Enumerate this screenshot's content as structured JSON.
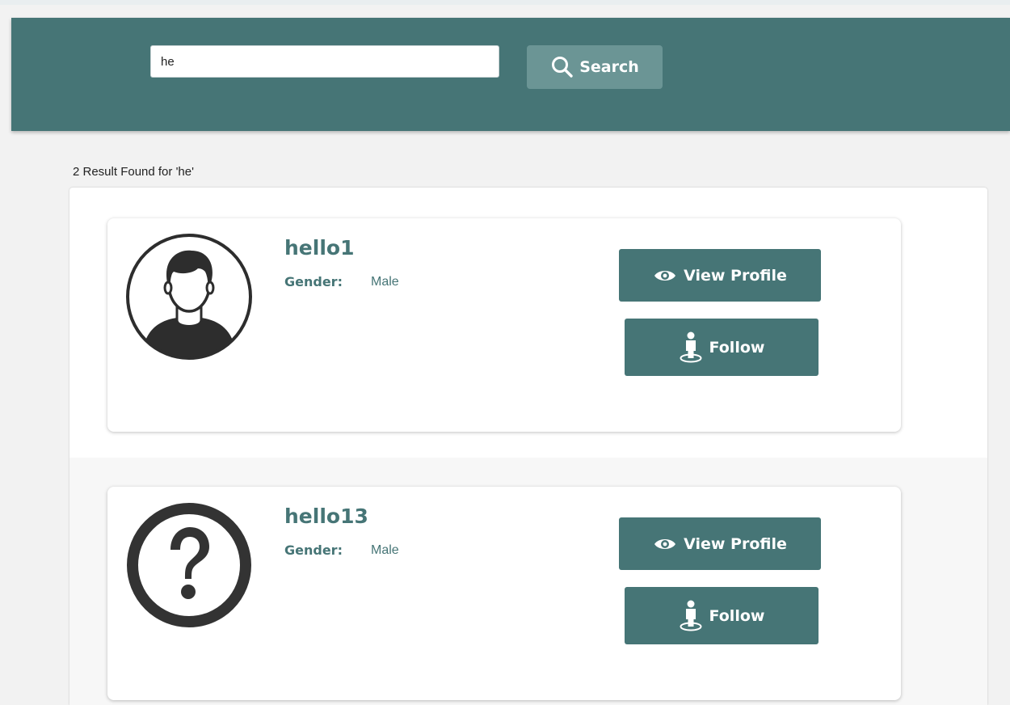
{
  "search": {
    "value": "he",
    "button_label": "Search",
    "icon": "search-icon"
  },
  "results": {
    "count_text": "2 Result Found for 'he'"
  },
  "users": [
    {
      "name": "hello1",
      "gender_label": "Gender:",
      "gender": "Male",
      "avatar_icon": "user-avatar-icon",
      "view_label": "View Profile",
      "follow_label": "Follow"
    },
    {
      "name": "hello13",
      "gender_label": "Gender:",
      "gender": "Male",
      "avatar_icon": "question-mark-icon",
      "view_label": "View Profile",
      "follow_label": "Follow"
    }
  ],
  "colors": {
    "accent": "#467576",
    "search_button": "#6b9595",
    "background": "#f2f2f2"
  }
}
